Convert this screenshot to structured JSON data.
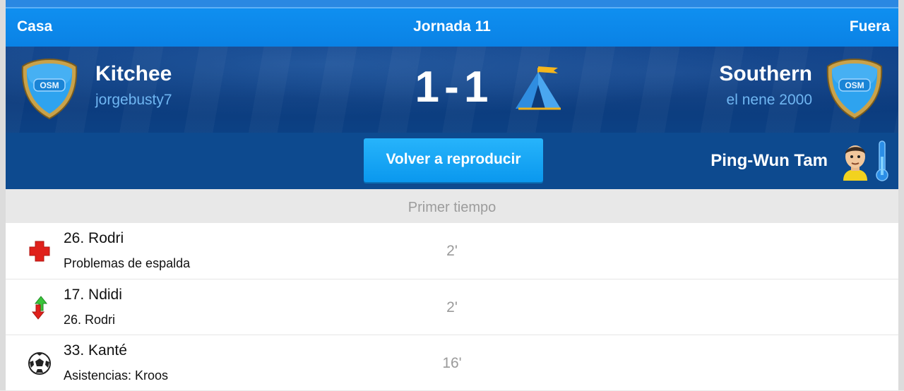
{
  "header": {
    "home_label": "Casa",
    "round_label": "Jornada 11",
    "away_label": "Fuera"
  },
  "match": {
    "home": {
      "team": "Kitchee",
      "manager": "jorgebusty7",
      "badge_text": "OSM"
    },
    "away": {
      "team": "Southern",
      "manager": "el nene 2000",
      "badge_text": "OSM"
    },
    "score": {
      "home": "1",
      "separator": "-",
      "away": "1"
    },
    "stadium_icon": "tent-icon"
  },
  "controls": {
    "replay_label": "Volver a reproducir",
    "referee_name": "Ping-Wun Tam",
    "referee_icon": "referee-avatar-icon",
    "thermometer_icon": "thermometer-icon"
  },
  "timeline": {
    "section_title": "Primer tiempo",
    "events": [
      {
        "type": "injury",
        "icon": "injury-cross-icon",
        "title": "26. Rodri",
        "detail": "Problemas de espalda",
        "minute": "2'"
      },
      {
        "type": "substitution",
        "icon": "substitution-arrows-icon",
        "title": "17. Ndidi",
        "detail": "26. Rodri",
        "minute": "2'"
      },
      {
        "type": "goal",
        "icon": "soccer-ball-icon",
        "title": "33. Kanté",
        "detail": "Asistencias: Kroos",
        "minute": "16'"
      }
    ]
  },
  "colors": {
    "header_blue": "#0a82e5",
    "scoreboard_navy": "#0b3a7c",
    "button_blue": "#0a98ee",
    "user_text_blue": "#6fb6f2",
    "injury_red": "#e0201b",
    "sub_green": "#39c43a"
  }
}
